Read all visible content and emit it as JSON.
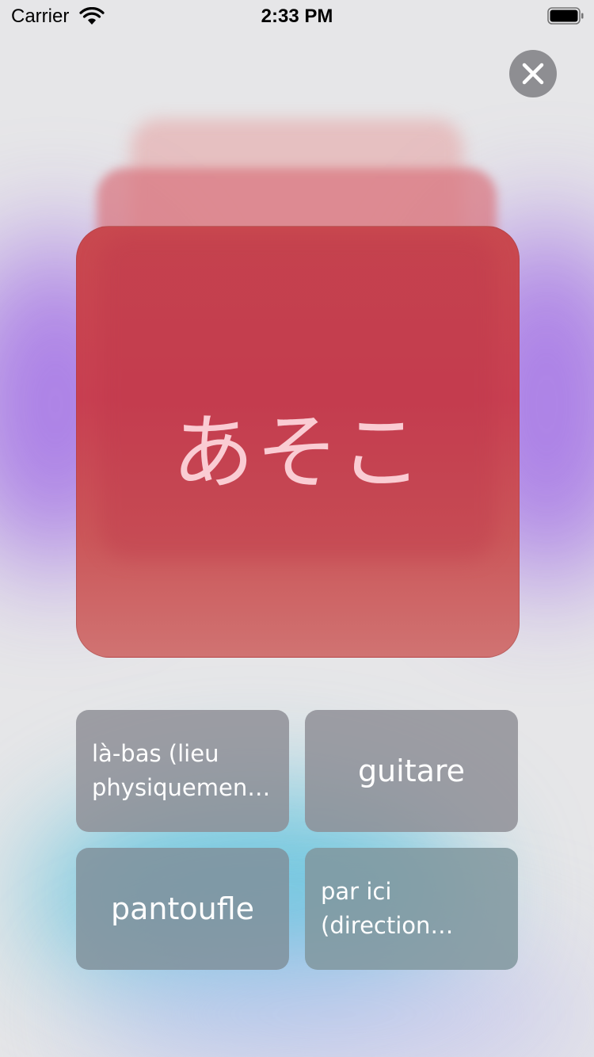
{
  "status_bar": {
    "carrier": "Carrier",
    "time": "2:33 PM",
    "wifi_icon": "wifi-icon",
    "battery_icon": "battery-icon"
  },
  "close_button": {
    "icon": "close-icon",
    "color": "#8e8e92"
  },
  "card": {
    "word": "あそこ",
    "color": "#c84651"
  },
  "answers": [
    {
      "label": "là-bas (lieu physiquement éloigné)"
    },
    {
      "label": "guitare"
    },
    {
      "label": "pantoufle"
    },
    {
      "label": "par ici (direction proche)"
    }
  ]
}
